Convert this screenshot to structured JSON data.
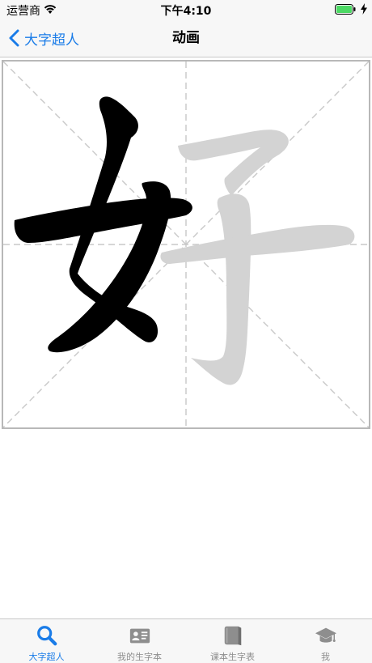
{
  "status_bar": {
    "carrier": "运营商",
    "time": "下午4:10"
  },
  "nav": {
    "back_label": "大字超人",
    "title": "动画"
  },
  "character": {
    "glyph": "好",
    "active_color": "#000000",
    "pending_color": "#d3d3d3"
  },
  "tabs": [
    {
      "label": "大字超人",
      "icon": "search-icon",
      "active": true
    },
    {
      "label": "我的生字本",
      "icon": "contact-card-icon",
      "active": false
    },
    {
      "label": "课本生字表",
      "icon": "book-icon",
      "active": false
    },
    {
      "label": "我",
      "icon": "graduation-cap-icon",
      "active": false
    }
  ],
  "colors": {
    "accent": "#1a7ce8",
    "bar_background": "#f7f7f7",
    "tab_inactive": "#8e8e8e",
    "grid_border": "#b8b8b8",
    "grid_guides": "#c8c8c8"
  }
}
